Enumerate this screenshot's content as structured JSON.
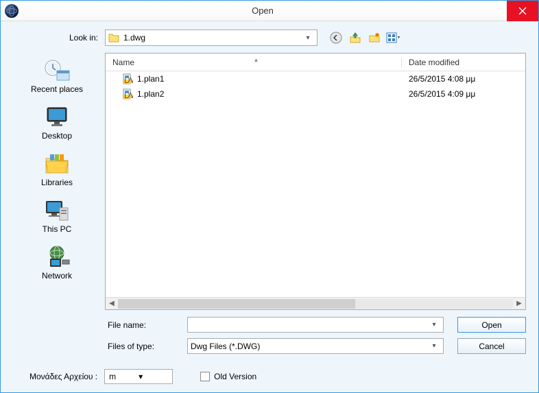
{
  "window": {
    "title": "Open"
  },
  "lookin": {
    "label": "Look in:",
    "value": "1.dwg"
  },
  "sidebar": {
    "items": [
      {
        "label": "Recent places"
      },
      {
        "label": "Desktop"
      },
      {
        "label": "Libraries"
      },
      {
        "label": "This PC"
      },
      {
        "label": "Network"
      }
    ]
  },
  "columns": {
    "name": "Name",
    "date": "Date modified"
  },
  "files": [
    {
      "name": "1.plan1",
      "date": "26/5/2015 4:08 μμ"
    },
    {
      "name": "1.plan2",
      "date": "26/5/2015 4:09 μμ"
    }
  ],
  "filename_label": "File name:",
  "filetype_label": "Files of type:",
  "filetype_value": "Dwg Files (*.DWG)",
  "open_btn": "Open",
  "cancel_btn": "Cancel",
  "units_label": "Μονάδες Αρχείου :",
  "units_value": "m",
  "oldversion_label": "Old Version"
}
